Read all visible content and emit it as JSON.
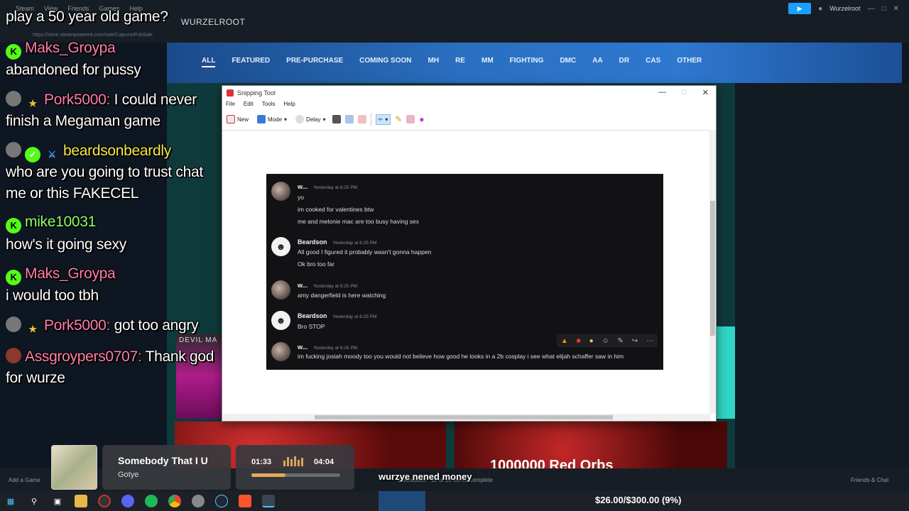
{
  "steam": {
    "menu": [
      "Steam",
      "View",
      "Friends",
      "Games",
      "Help"
    ],
    "nav_user": "WURZELROOT",
    "url": "https://store.steampowered.com/sale/CapcomPubSale",
    "account_name": "Wurzelroot",
    "tabs": [
      "ALL",
      "FEATURED",
      "PRE-PURCHASE",
      "COMING SOON",
      "MH",
      "RE",
      "MM",
      "FIGHTING",
      "DMC",
      "AA",
      "DR",
      "CAS",
      "OTHER"
    ],
    "dm_label": "DEVIL MA",
    "orbs_text": "1000000 Red Orbs",
    "add_game": "Add a Game",
    "downloads": "Downloads · 10 of 10 Items Complete",
    "friends_chat": "Friends & Chat"
  },
  "chat": [
    {
      "user": "",
      "text": "play a 50 year old game?"
    },
    {
      "user": "Maks_Groypa",
      "text": "abandoned for pussy"
    },
    {
      "user": "Pork5000:",
      "text": "I could never"
    },
    {
      "user": "",
      "text": "finish a Megaman game"
    },
    {
      "user": "beardsonbeardly",
      "text": ""
    },
    {
      "user": "",
      "text": "who are you going to trust chat"
    },
    {
      "user": "",
      "text": "me or this FAKECEL"
    },
    {
      "user": "mike10031",
      "text": ""
    },
    {
      "user": "",
      "text": "how's it going sexy"
    },
    {
      "user": "Maks_Groypa",
      "text": ""
    },
    {
      "user": "",
      "text": "i would too tbh"
    },
    {
      "user": "Pork5000:",
      "text": "got too angry"
    },
    {
      "user": "Assgroypers0707:",
      "text": "Thank god"
    },
    {
      "user": "",
      "text": "for wurze"
    }
  ],
  "snip": {
    "title": "Snipping Tool",
    "menu": [
      "File",
      "Edit",
      "Tools",
      "Help"
    ],
    "new_label": "New",
    "mode_label": "Mode",
    "delay_label": "Delay"
  },
  "discord": {
    "messages": [
      {
        "author": "w...",
        "time": "Yesterday at 6:25 PM",
        "lines": [
          "yo",
          "im cooked for valentines btw",
          "me and melonie mac are too busy having sex"
        ]
      },
      {
        "author": "Beardson",
        "time": "Yesterday at 6:25 PM",
        "lines": [
          "All good I figured it probably wasn't gonna happen",
          "Ok bro too far"
        ]
      },
      {
        "author": "w...",
        "time": "Yesterday at 6:25 PM",
        "lines": [
          "amy dangerfield is here watching"
        ]
      },
      {
        "author": "Beardson",
        "time": "Yesterday at 6:25 PM",
        "lines": [
          "Bro STOP"
        ]
      },
      {
        "author": "w...",
        "time": "Yesterday at 6:26 PM",
        "lines": [
          "im fucking josiah moody too you would not believe how good he looks in a 2b cosplay i see what elijah schaffer saw in him"
        ]
      }
    ]
  },
  "music": {
    "title": "Somebody That I U",
    "artist": "Gotye",
    "current": "01:33",
    "total": "04:04",
    "progress": 0.38
  },
  "overlay_message": "wurzye nened money",
  "goal": "$26.00/$300.00 (9%)",
  "colors": {
    "kick_green": "#53fc18",
    "steam_blue": "#1a9fff",
    "accent_orange": "#e9a85a"
  }
}
